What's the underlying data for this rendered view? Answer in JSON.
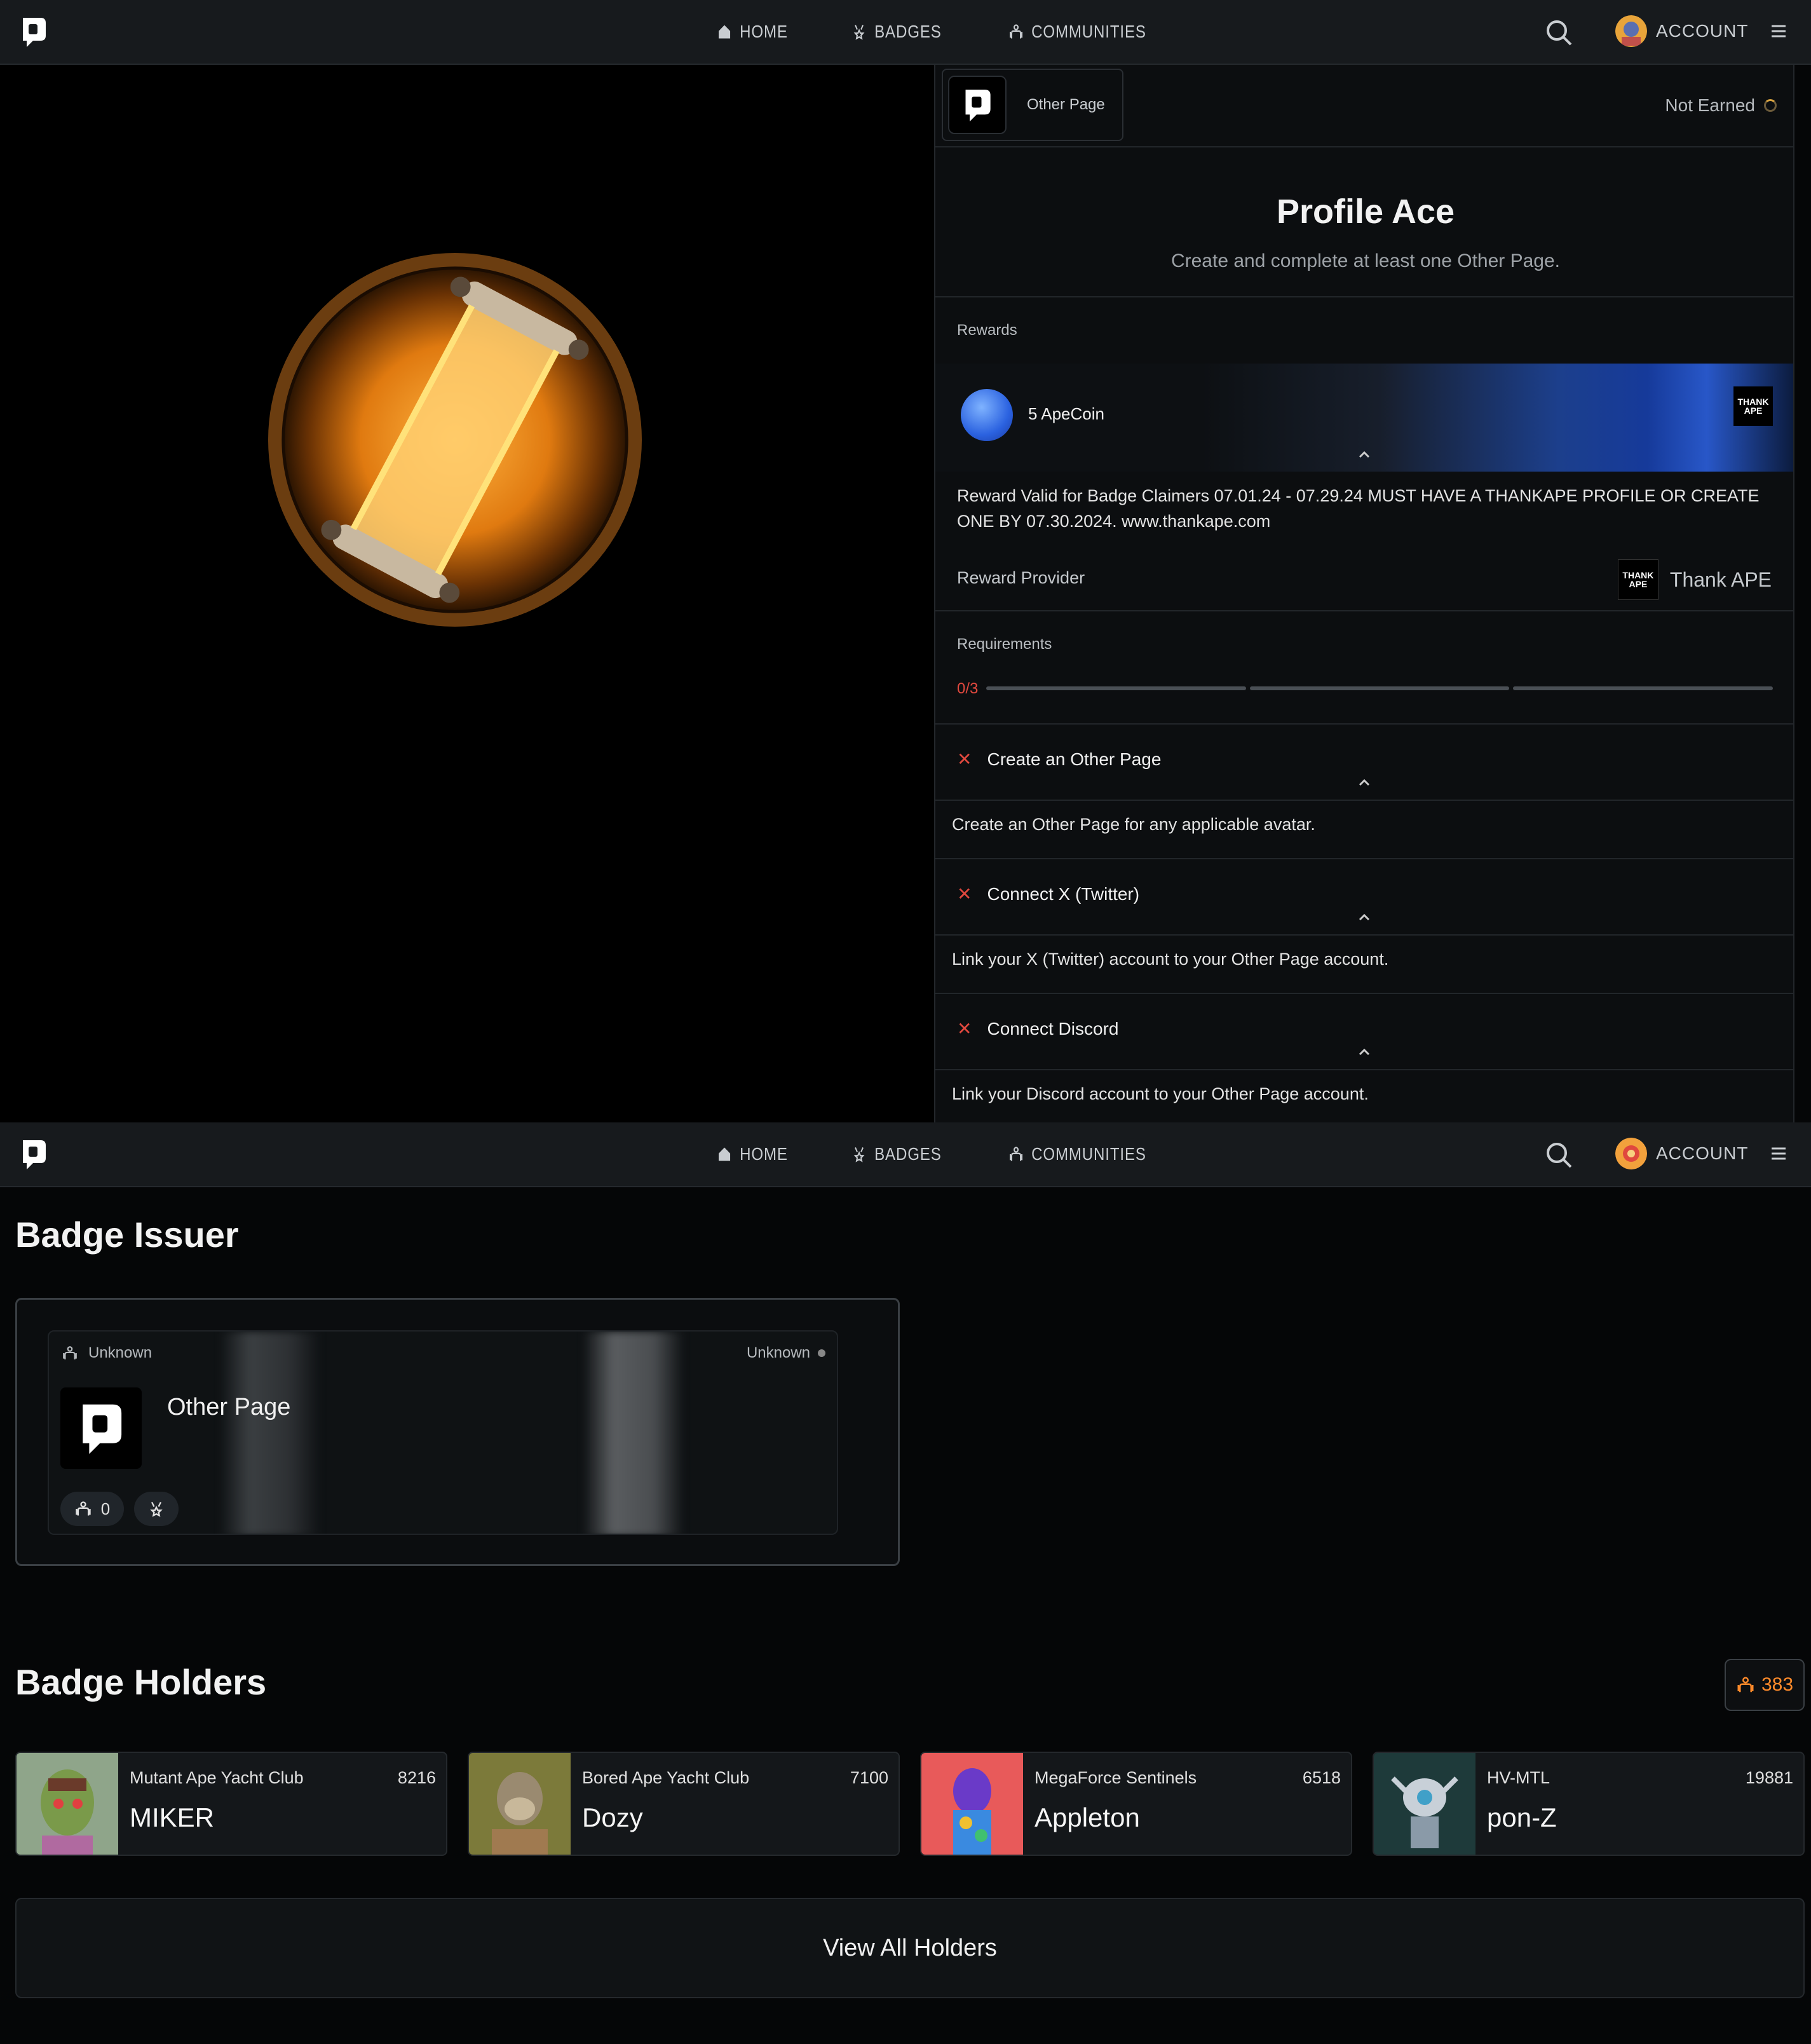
{
  "nav": {
    "home": "HOME",
    "badges": "BADGES",
    "communities": "COMMUNITIES",
    "account": "ACCOUNT"
  },
  "badge": {
    "issuer_chip": "Other Page",
    "status": "Not Earned",
    "title": "Profile Ace",
    "subtitle": "Create and complete at least one Other Page."
  },
  "rewards": {
    "label": "Rewards",
    "coin_text": "5 ApeCoin",
    "thank_logo": "THANK APE",
    "description": "Reward Valid for Badge Claimers 07.01.24 - 07.29.24 MUST HAVE A THANKAPE PROFILE OR CREATE ONE BY 07.30.2024. www.thankape.com",
    "provider_label": "Reward Provider",
    "provider_name": "Thank APE"
  },
  "requirements": {
    "label": "Requirements",
    "progress_text": "0/3",
    "progress": 0,
    "items": [
      {
        "title": "Create an Other Page",
        "desc": "Create an Other Page for any applicable avatar."
      },
      {
        "title": "Connect X (Twitter)",
        "desc": "Link your X (Twitter) account to your Other Page account."
      },
      {
        "title": "Connect Discord",
        "desc": "Link your Discord account to your Other Page account."
      }
    ]
  },
  "issuer": {
    "heading": "Badge Issuer",
    "category": "Unknown",
    "status": "Unknown",
    "name": "Other Page",
    "members": "0"
  },
  "holders": {
    "heading": "Badge Holders",
    "count": "383",
    "items": [
      {
        "collection": "Mutant Ape Yacht Club",
        "number": "8216",
        "name": "MIKER"
      },
      {
        "collection": "Bored Ape Yacht Club",
        "number": "7100",
        "name": "Dozy"
      },
      {
        "collection": "MegaForce Sentinels",
        "number": "6518",
        "name": "Appleton"
      },
      {
        "collection": "HV-MTL",
        "number": "19881",
        "name": "pon-Z"
      }
    ],
    "view_all": "View All Holders"
  },
  "colors": {
    "accent_orange": "#ff8a2a",
    "error_red": "#e0483e",
    "background": "#050607"
  }
}
